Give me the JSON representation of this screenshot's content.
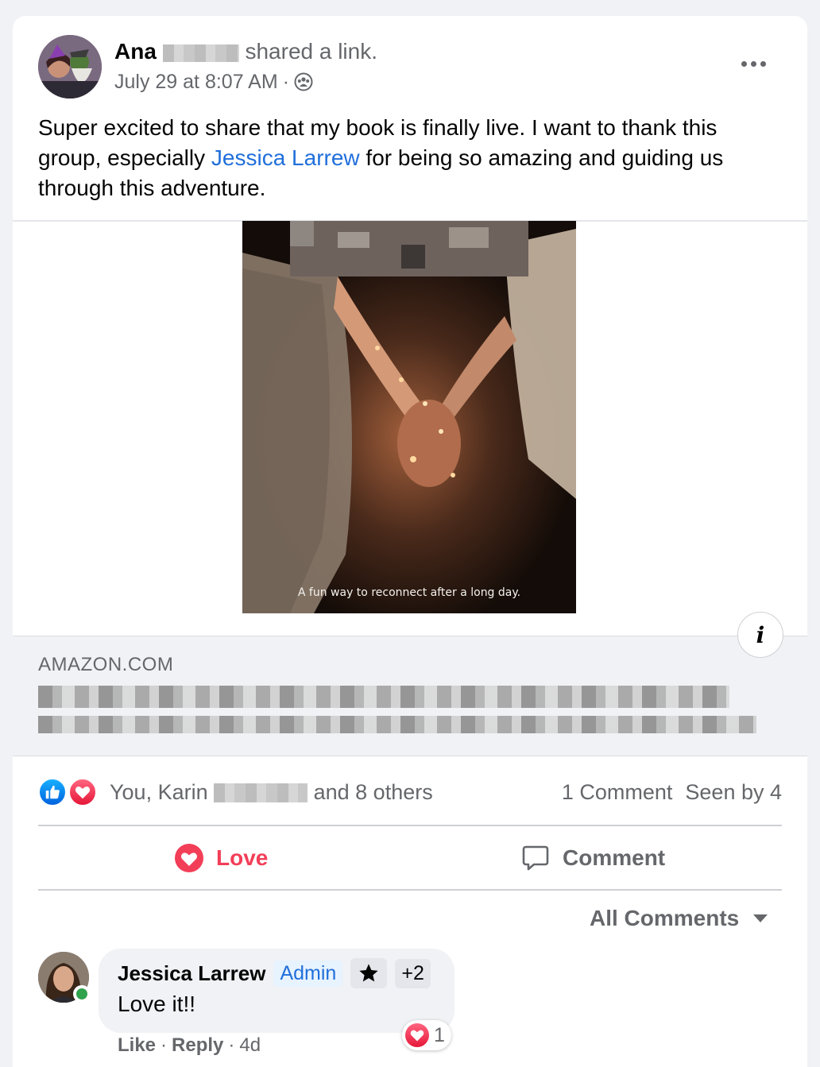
{
  "post": {
    "author_first": "Ana",
    "shared_text": "shared a link.",
    "timestamp": "July 29 at 8:07 AM",
    "separator": "·",
    "audience_icon": "group-icon",
    "more_icon": "more-options-icon",
    "text_before": "Super excited to share that my book is finally live. I want to thank this group, especially ",
    "mention": "Jessica Larrew",
    "text_after": " for being so amazing and guiding us through this adventure."
  },
  "link_preview": {
    "cover_caption": "A fun way to reconnect after a long day.",
    "info_label": "i",
    "domain": "AMAZON.COM"
  },
  "reactions": {
    "names_before": "You, Karin ",
    "names_after": " and 8 others",
    "comments_count": "1 Comment",
    "seen_by": "Seen by 4",
    "icons": [
      "like-icon",
      "love-icon"
    ]
  },
  "actions": {
    "love_label": "Love",
    "comment_label": "Comment"
  },
  "comments_filter": {
    "label": "All Comments"
  },
  "comment": {
    "author": "Jessica Larrew",
    "admin_badge": "Admin",
    "extra_badges": "+2",
    "text": "Love it!!",
    "reaction_count": "1",
    "like_label": "Like",
    "reply_label": "Reply",
    "age": "4d",
    "dot": "·"
  },
  "colors": {
    "accent_blue": "#216fdb",
    "love_red": "#f33e58",
    "secondary_text": "#65676b",
    "online_green": "#31a24c"
  }
}
